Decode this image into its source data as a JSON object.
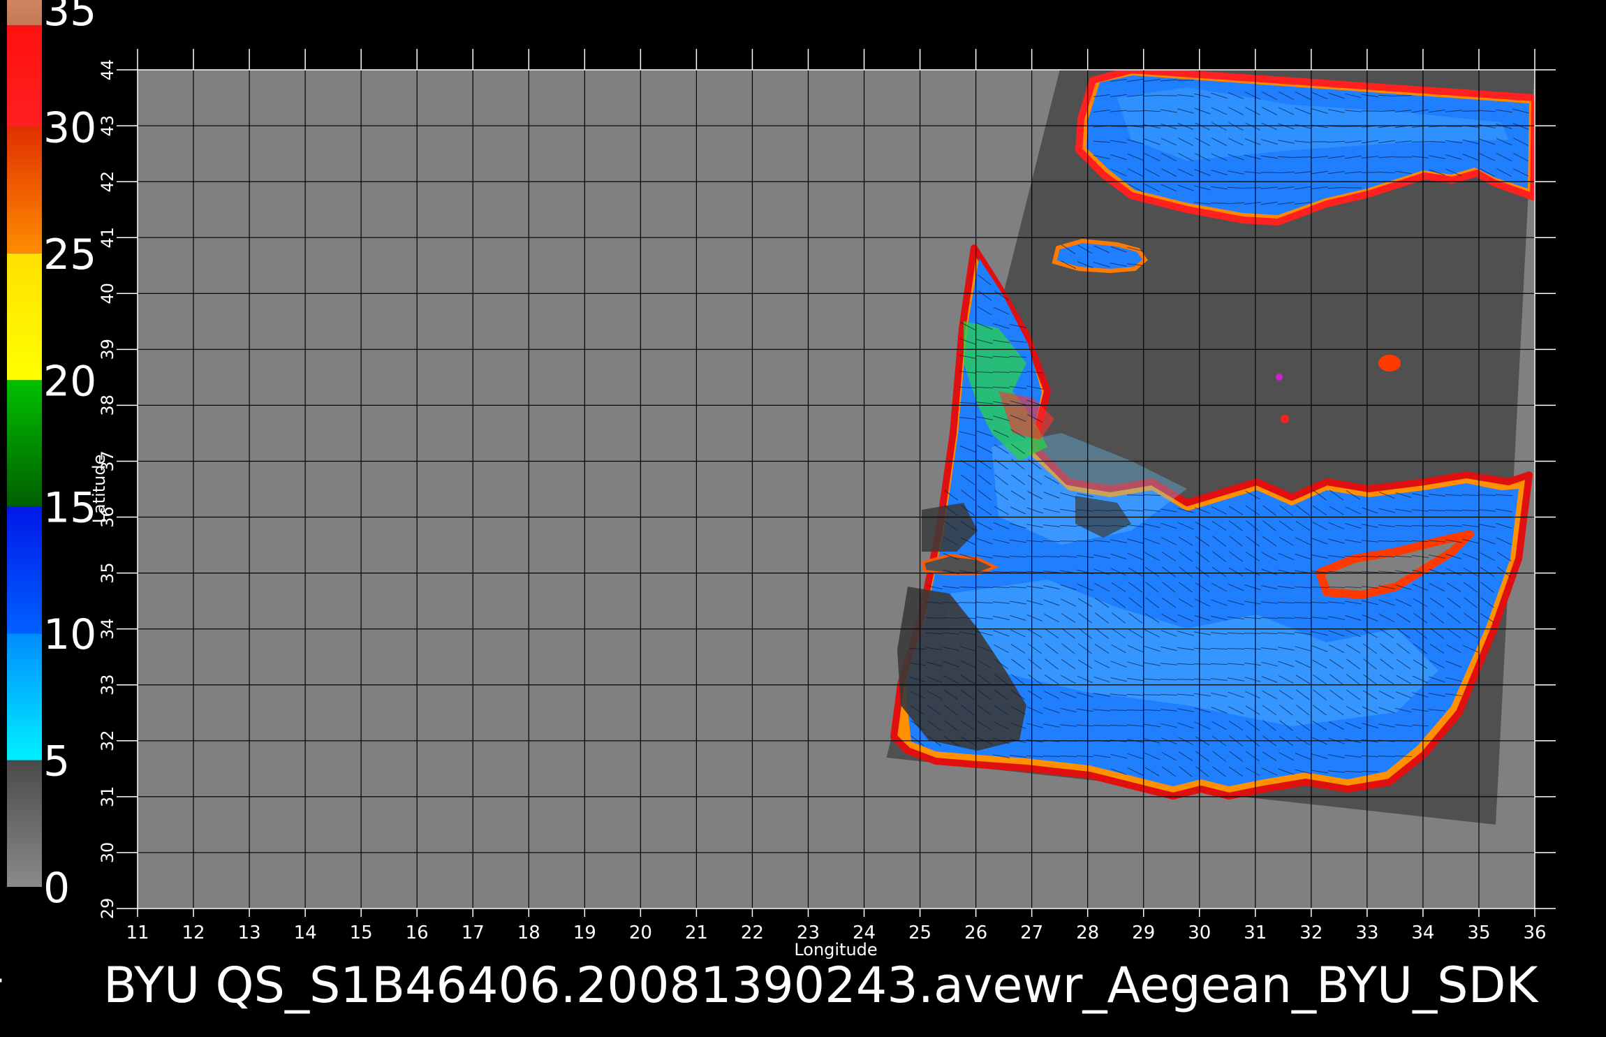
{
  "title": "BYU  QS_S1B46406.20081390243.avewr_Aegean_BYU_SDK",
  "xlabel": "Longitude",
  "ylabel": "Latitude",
  "colorbar": {
    "labels": [
      "35",
      "30",
      "25",
      "20",
      "15",
      "10",
      "5",
      "0"
    ],
    "values": [
      35,
      30,
      25,
      20,
      15,
      10,
      5,
      0
    ],
    "segments": [
      {
        "from": 0,
        "to": 5,
        "top": "#4a4a4a",
        "bottom": "#8a8a8a"
      },
      {
        "from": 5,
        "to": 10,
        "top": "#008cff",
        "bottom": "#00f0ff"
      },
      {
        "from": 10,
        "to": 15,
        "top": "#0018e8",
        "bottom": "#0060ff"
      },
      {
        "from": 15,
        "to": 20,
        "top": "#00c000",
        "bottom": "#005e00"
      },
      {
        "from": 20,
        "to": 25,
        "top": "#ffe000",
        "bottom": "#ffff00"
      },
      {
        "from": 25,
        "to": 30,
        "top": "#e03000",
        "bottom": "#ff8c00"
      },
      {
        "from": 30,
        "to": 34,
        "top": "#ff1010",
        "bottom": "#ff2020"
      },
      {
        "from": 34,
        "to": 35,
        "top": "#d28560",
        "bottom": "#c07a56"
      }
    ]
  },
  "map": {
    "lon_range": [
      11,
      36
    ],
    "lat_range": [
      29,
      44
    ],
    "x_ticks": [
      "11",
      "12",
      "13",
      "14",
      "15",
      "16",
      "17",
      "18",
      "19",
      "20",
      "21",
      "22",
      "23",
      "24",
      "25",
      "26",
      "27",
      "28",
      "29",
      "30",
      "31",
      "32",
      "33",
      "34",
      "35",
      "36"
    ],
    "y_ticks": [
      "29",
      "30",
      "31",
      "32",
      "33",
      "34",
      "35",
      "36",
      "37",
      "38",
      "39",
      "40",
      "41",
      "42",
      "43",
      "44"
    ],
    "background_color": "#808080",
    "swath_color": "#505050",
    "land_color": "#4a4a4a",
    "sea_color": "#1f7fff",
    "swath_corners": [
      [
        27.5,
        44
      ],
      [
        36,
        44
      ],
      [
        35.3,
        30.5
      ],
      [
        24.4,
        31.7
      ]
    ]
  }
}
